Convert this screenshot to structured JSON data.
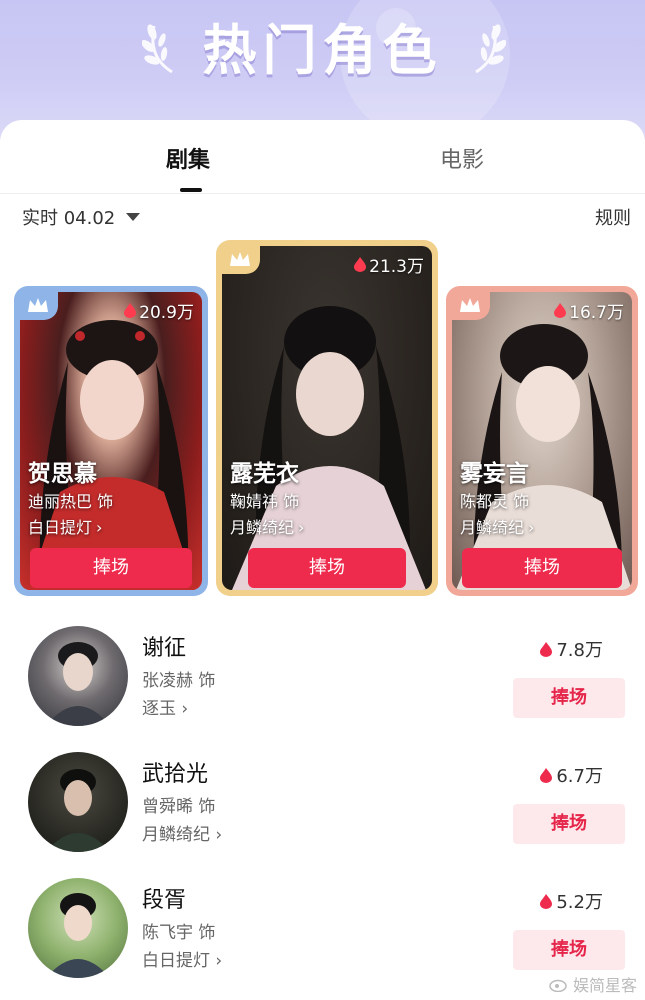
{
  "header": {
    "title": "热门角色"
  },
  "tabs": [
    {
      "label": "剧集",
      "active": true
    },
    {
      "label": "电影",
      "active": false
    }
  ],
  "filter": {
    "date_label": "实时 04.02",
    "rules_label": "规则"
  },
  "top_cards": [
    {
      "rank": 2,
      "heat": "20.9万",
      "name": "贺思慕",
      "actor": "迪丽热巴 饰",
      "show": "白日提灯",
      "button": "捧场",
      "frame_color": "#8fb4e8"
    },
    {
      "rank": 1,
      "heat": "21.3万",
      "name": "露芜衣",
      "actor": "鞠婧祎 饰",
      "show": "月鳞绮纪",
      "button": "捧场",
      "frame_color": "#f0d08a"
    },
    {
      "rank": 3,
      "heat": "16.7万",
      "name": "雾妄言",
      "actor": "陈都灵 饰",
      "show": "月鳞绮纪",
      "button": "捧场",
      "frame_color": "#f2a898"
    }
  ],
  "list": [
    {
      "heat": "7.8万",
      "name": "谢征",
      "actor": "张凌赫 饰",
      "show": "逐玉",
      "button": "捧场"
    },
    {
      "heat": "6.7万",
      "name": "武拾光",
      "actor": "曾舜晞 饰",
      "show": "月鳞绮纪",
      "button": "捧场"
    },
    {
      "heat": "5.2万",
      "name": "段胥",
      "actor": "陈飞宇 饰",
      "show": "白日提灯",
      "button": "捧场"
    }
  ],
  "watermark": "娱简星客",
  "colors": {
    "accent": "#ee2b4d",
    "header_bg": "#c7c5f3"
  }
}
